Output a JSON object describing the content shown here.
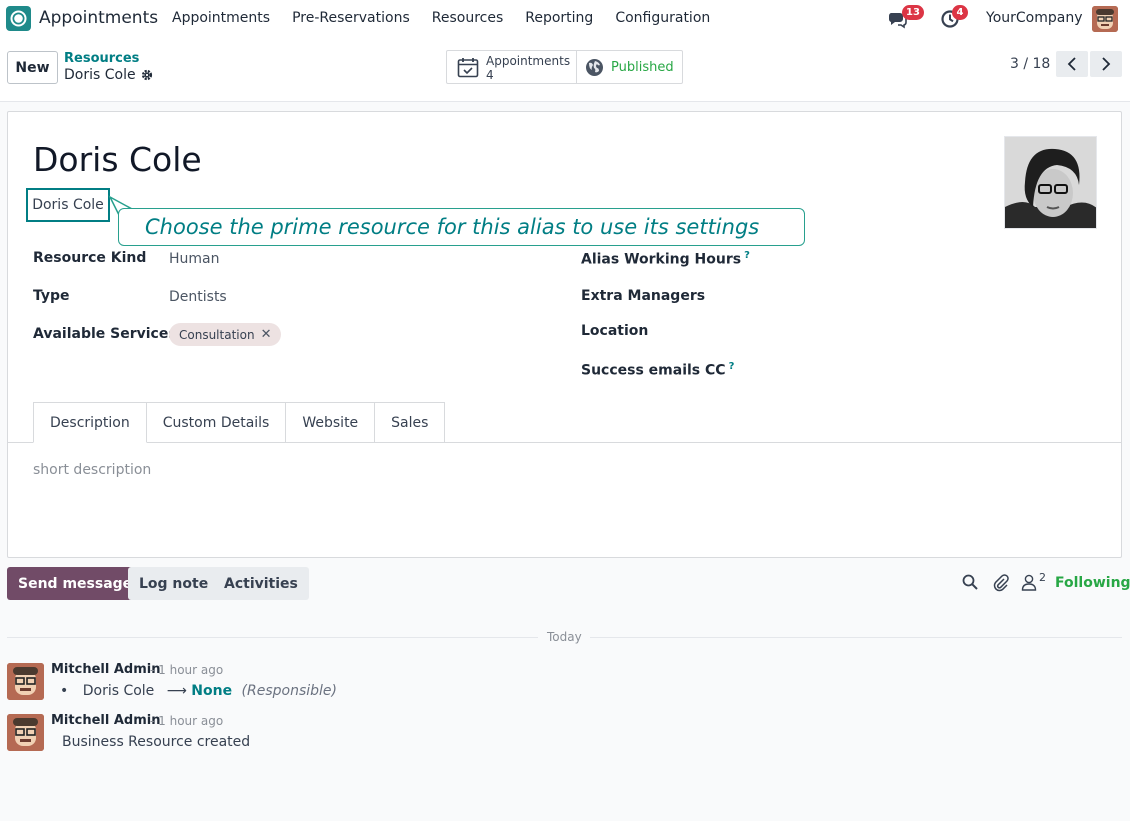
{
  "navbar": {
    "app_name": "Appointments",
    "menu": [
      "Appointments",
      "Pre-Reservations",
      "Resources",
      "Reporting",
      "Configuration"
    ],
    "messages_badge": "13",
    "activities_badge": "4",
    "company": "YourCompany"
  },
  "control_panel": {
    "new_label": "New",
    "breadcrumb_parent": "Resources",
    "breadcrumb_current": "Doris Cole",
    "smart_appointments_label": "Appointments",
    "smart_appointments_count": "4",
    "published_label": "Published",
    "pager": "3 / 18"
  },
  "form": {
    "name": "Doris Cole",
    "alias_value": "Doris Cole",
    "tooltip": "Choose the prime resource for this alias to use its settings",
    "left_fields": [
      {
        "label": "Resource Kind",
        "value": "Human"
      },
      {
        "label": "Type",
        "value": "Dentists"
      },
      {
        "label": "Available Services",
        "value": ""
      }
    ],
    "service_tag": "Consultation",
    "right_fields": [
      {
        "label": "Alias Working Hours",
        "help": "?"
      },
      {
        "label": "Extra Managers",
        "help": ""
      },
      {
        "label": "Location",
        "help": ""
      },
      {
        "label": "Success emails CC",
        "help": "?"
      }
    ],
    "tabs": [
      "Description",
      "Custom Details",
      "Website",
      "Sales"
    ],
    "description_placeholder": "short description"
  },
  "chatter": {
    "send_label": "Send message",
    "log_label": "Log note",
    "activities_label": "Activities",
    "followers_count": "2",
    "following_label": "Following",
    "date_separator": "Today",
    "messages": [
      {
        "author": "Mitchell Admin",
        "time": "- 1 hour ago",
        "change_old": "Doris Cole",
        "change_new": "None",
        "change_field": "(Responsible)"
      },
      {
        "author": "Mitchell Admin",
        "time": "- 1 hour ago",
        "body": "Business Resource created"
      }
    ]
  },
  "colors": {
    "brand": "#714b67",
    "accent": "#017e84",
    "success": "#28a745",
    "badge": "#dc3545"
  }
}
